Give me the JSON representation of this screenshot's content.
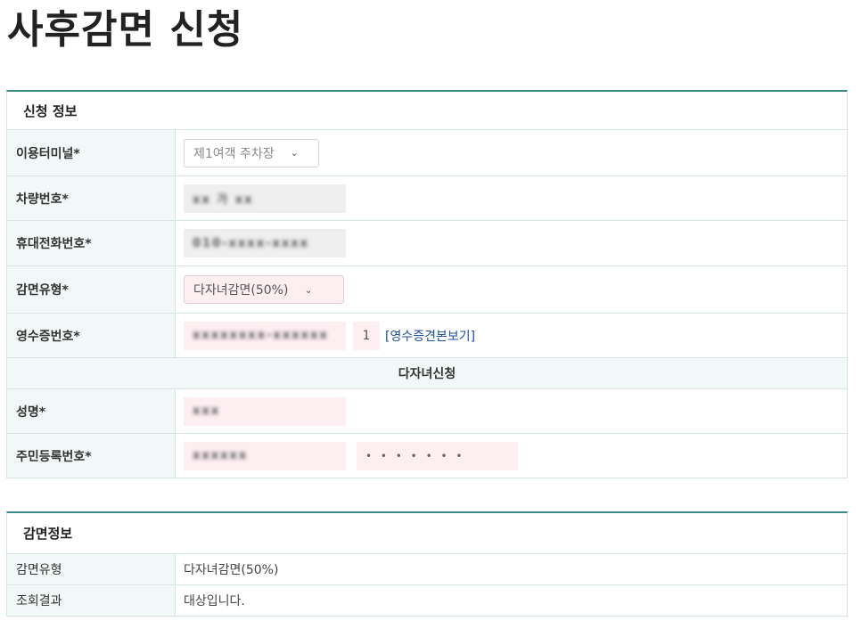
{
  "page_title": "사후감면 신청",
  "apply_section": {
    "title": "신청 정보",
    "terminal": {
      "label": "이용터미널*",
      "value": "제1여객 주차장"
    },
    "vehicle": {
      "label": "차량번호*",
      "value": "xx 가 xx"
    },
    "phone": {
      "label": "휴대전화번호*",
      "value": "010-xxxx-xxxx"
    },
    "discount_type": {
      "label": "감면유형*",
      "value": "다자녀감면(50%)"
    },
    "receipt": {
      "label": "영수증번호*",
      "value": "xxxxxxxx-xxxxxx",
      "seq": "1",
      "link": "[영수증견본보기]"
    },
    "multi_child_title": "다자녀신청",
    "name": {
      "label": "성명*",
      "value": "xxx"
    },
    "rrn": {
      "label": "주민등록번호*",
      "front": "xxxxxx",
      "back": "• • • • • • •"
    }
  },
  "discount_section": {
    "title": "감면정보",
    "rows": [
      {
        "label": "감면유형",
        "value": "다자녀감면(50%)"
      },
      {
        "label": "조회결과",
        "value": "대상입니다."
      }
    ]
  }
}
